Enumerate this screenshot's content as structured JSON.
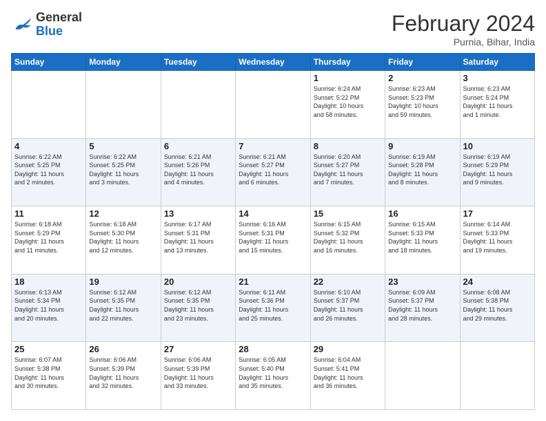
{
  "header": {
    "logo_general": "General",
    "logo_blue": "Blue",
    "month_title": "February 2024",
    "location": "Purnia, Bihar, India"
  },
  "weekdays": [
    "Sunday",
    "Monday",
    "Tuesday",
    "Wednesday",
    "Thursday",
    "Friday",
    "Saturday"
  ],
  "weeks": [
    [
      {
        "day": "",
        "info": ""
      },
      {
        "day": "",
        "info": ""
      },
      {
        "day": "",
        "info": ""
      },
      {
        "day": "",
        "info": ""
      },
      {
        "day": "1",
        "info": "Sunrise: 6:24 AM\nSunset: 5:22 PM\nDaylight: 10 hours\nand 58 minutes."
      },
      {
        "day": "2",
        "info": "Sunrise: 6:23 AM\nSunset: 5:23 PM\nDaylight: 10 hours\nand 59 minutes."
      },
      {
        "day": "3",
        "info": "Sunrise: 6:23 AM\nSunset: 5:24 PM\nDaylight: 11 hours\nand 1 minute."
      }
    ],
    [
      {
        "day": "4",
        "info": "Sunrise: 6:22 AM\nSunset: 5:25 PM\nDaylight: 11 hours\nand 2 minutes."
      },
      {
        "day": "5",
        "info": "Sunrise: 6:22 AM\nSunset: 5:25 PM\nDaylight: 11 hours\nand 3 minutes."
      },
      {
        "day": "6",
        "info": "Sunrise: 6:21 AM\nSunset: 5:26 PM\nDaylight: 11 hours\nand 4 minutes."
      },
      {
        "day": "7",
        "info": "Sunrise: 6:21 AM\nSunset: 5:27 PM\nDaylight: 11 hours\nand 6 minutes."
      },
      {
        "day": "8",
        "info": "Sunrise: 6:20 AM\nSunset: 5:27 PM\nDaylight: 11 hours\nand 7 minutes."
      },
      {
        "day": "9",
        "info": "Sunrise: 6:19 AM\nSunset: 5:28 PM\nDaylight: 11 hours\nand 8 minutes."
      },
      {
        "day": "10",
        "info": "Sunrise: 6:19 AM\nSunset: 5:29 PM\nDaylight: 11 hours\nand 9 minutes."
      }
    ],
    [
      {
        "day": "11",
        "info": "Sunrise: 6:18 AM\nSunset: 5:29 PM\nDaylight: 11 hours\nand 11 minutes."
      },
      {
        "day": "12",
        "info": "Sunrise: 6:18 AM\nSunset: 5:30 PM\nDaylight: 11 hours\nand 12 minutes."
      },
      {
        "day": "13",
        "info": "Sunrise: 6:17 AM\nSunset: 5:31 PM\nDaylight: 11 hours\nand 13 minutes."
      },
      {
        "day": "14",
        "info": "Sunrise: 6:16 AM\nSunset: 5:31 PM\nDaylight: 11 hours\nand 15 minutes."
      },
      {
        "day": "15",
        "info": "Sunrise: 6:15 AM\nSunset: 5:32 PM\nDaylight: 11 hours\nand 16 minutes."
      },
      {
        "day": "16",
        "info": "Sunrise: 6:15 AM\nSunset: 5:33 PM\nDaylight: 11 hours\nand 18 minutes."
      },
      {
        "day": "17",
        "info": "Sunrise: 6:14 AM\nSunset: 5:33 PM\nDaylight: 11 hours\nand 19 minutes."
      }
    ],
    [
      {
        "day": "18",
        "info": "Sunrise: 6:13 AM\nSunset: 5:34 PM\nDaylight: 11 hours\nand 20 minutes."
      },
      {
        "day": "19",
        "info": "Sunrise: 6:12 AM\nSunset: 5:35 PM\nDaylight: 11 hours\nand 22 minutes."
      },
      {
        "day": "20",
        "info": "Sunrise: 6:12 AM\nSunset: 5:35 PM\nDaylight: 11 hours\nand 23 minutes."
      },
      {
        "day": "21",
        "info": "Sunrise: 6:11 AM\nSunset: 5:36 PM\nDaylight: 11 hours\nand 25 minutes."
      },
      {
        "day": "22",
        "info": "Sunrise: 6:10 AM\nSunset: 5:37 PM\nDaylight: 11 hours\nand 26 minutes."
      },
      {
        "day": "23",
        "info": "Sunrise: 6:09 AM\nSunset: 5:37 PM\nDaylight: 11 hours\nand 28 minutes."
      },
      {
        "day": "24",
        "info": "Sunrise: 6:08 AM\nSunset: 5:38 PM\nDaylight: 11 hours\nand 29 minutes."
      }
    ],
    [
      {
        "day": "25",
        "info": "Sunrise: 6:07 AM\nSunset: 5:38 PM\nDaylight: 11 hours\nand 30 minutes."
      },
      {
        "day": "26",
        "info": "Sunrise: 6:06 AM\nSunset: 5:39 PM\nDaylight: 11 hours\nand 32 minutes."
      },
      {
        "day": "27",
        "info": "Sunrise: 6:06 AM\nSunset: 5:39 PM\nDaylight: 11 hours\nand 33 minutes."
      },
      {
        "day": "28",
        "info": "Sunrise: 6:05 AM\nSunset: 5:40 PM\nDaylight: 11 hours\nand 35 minutes."
      },
      {
        "day": "29",
        "info": "Sunrise: 6:04 AM\nSunset: 5:41 PM\nDaylight: 11 hours\nand 36 minutes."
      },
      {
        "day": "",
        "info": ""
      },
      {
        "day": "",
        "info": ""
      }
    ]
  ]
}
